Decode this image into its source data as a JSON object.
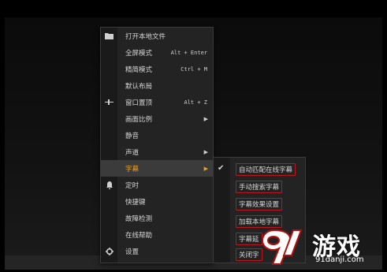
{
  "menu": {
    "items": [
      {
        "label": "打开本地文件",
        "icon": "folder-icon"
      },
      {
        "label": "全屏模式",
        "shortcut": "Alt + Enter"
      },
      {
        "label": "精简模式",
        "shortcut": "Ctrl + M"
      },
      {
        "label": "默认布局"
      },
      {
        "label": "窗口置顶",
        "shortcut": "Alt + Z",
        "icon": "pin-icon"
      },
      {
        "label": "画面比例",
        "arrow": "▶"
      },
      {
        "label": "静音"
      },
      {
        "label": "声道",
        "arrow": "▶"
      },
      {
        "label": "字幕",
        "arrow": "▶"
      },
      {
        "label": "定时",
        "icon": "bell-icon"
      },
      {
        "label": "快捷键"
      },
      {
        "label": "故障检测"
      },
      {
        "label": "在线帮助"
      },
      {
        "label": "设置",
        "icon": "gear-icon"
      }
    ]
  },
  "submenu": {
    "items": [
      {
        "label": "自动匹配在线字幕",
        "checked": true
      },
      {
        "label": "手动搜索字幕"
      },
      {
        "label": "字幕效果设置"
      },
      {
        "label": "加载本地字幕"
      },
      {
        "label": "字幕延"
      },
      {
        "label": "关闭字"
      }
    ]
  },
  "watermark": {
    "brand": "游戏",
    "url": "91danji.com",
    "logo_text": "91"
  },
  "colors": {
    "menu_bg": "#232323",
    "active_bg": "#3b3b3b",
    "active_text": "#f0a020",
    "highlight_box": "#c0141c"
  }
}
